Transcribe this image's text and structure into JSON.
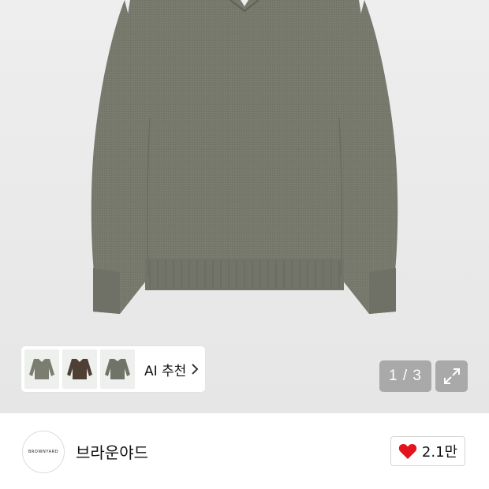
{
  "product": {
    "image_alt": "olive green v-neck knit sweater",
    "sweater_color": "#77796c"
  },
  "ai_recommend": {
    "label": "AI 추천",
    "thumbnail_colors": [
      "#7b7d70",
      "#4f4036",
      "#707367"
    ]
  },
  "gallery": {
    "page_indicator": "1 / 3"
  },
  "brand": {
    "logo_text": "BROWNYARD",
    "name": "브라운야드"
  },
  "like": {
    "count": "2.1만",
    "heart_color": "#e4141e"
  },
  "icons": [
    "chevron-right-icon",
    "expand-icon",
    "heart-icon"
  ]
}
